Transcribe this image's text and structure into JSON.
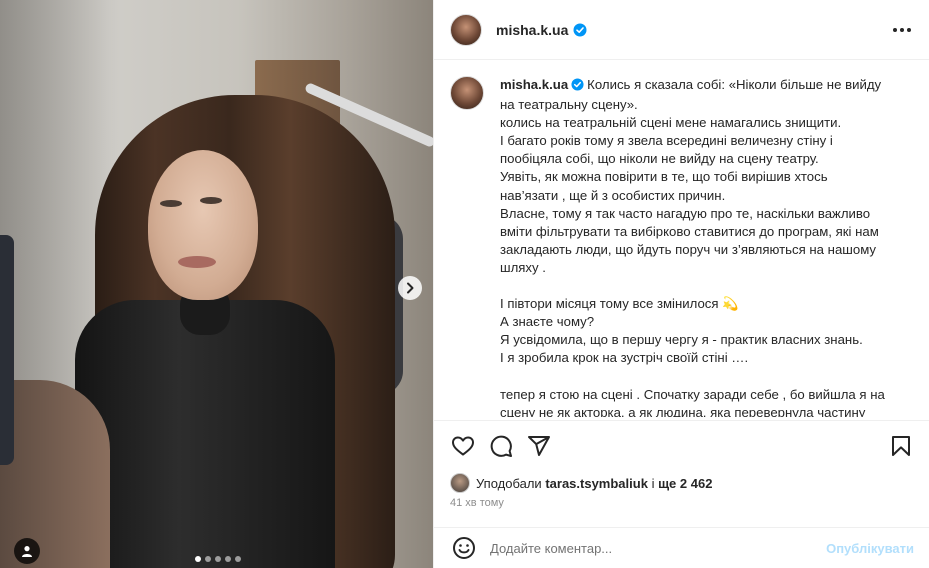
{
  "post": {
    "username": "misha.k.ua",
    "verified": true,
    "carousel": {
      "total_slides": 5,
      "current_slide": 1
    }
  },
  "caption": {
    "username": "misha.k.ua",
    "first_line": "Колись я сказала собі: «Ніколи більше не вийду",
    "lines": [
      "на театральну сцену».",
      "колись на театральній сцені мене намагались знищити.",
      "І багато років тому я звела всередині величезну стіну і",
      "пообіцяла собі, що ніколи не вийду на сцену театру.",
      "Уявіть, як можна повірити в те, що тобі вирішив хтось",
      "нав’язати , ще й з особистих причин.",
      "Власне, тому я так часто нагадую про те, наскільки важливо",
      "вміти фільтрувати та вибірково ставитися до програм, які нам",
      "закладають люди, що йдуть поруч чи з’являються на нашому",
      "шляху .",
      "",
      "І півтори місяця тому все змінилося 💫",
      "А знаєте чому?",
      "Я усвідомила, що в першу чергу я - практик власних знань.",
      "І я зробила крок на зустріч своїй стіні ….",
      "",
      "тепер я стою на сцені . Спочатку заради себе , бо вийшла я на",
      "сцену не як акторка, а як людина, яка перевернула частину"
    ]
  },
  "likes": {
    "prefix": "Уподобали",
    "user": "taras.tsymbaliuk",
    "connector": "і",
    "count": "ще 2 462"
  },
  "time_ago": "41 хв тому",
  "comment": {
    "placeholder": "Додайте коментар...",
    "post_label": "Опублікувати"
  },
  "colors": {
    "verified_blue": "#0095f6",
    "post_button_disabled": "#b2dffc",
    "secondary_text": "#8e8e8e"
  },
  "icons": {
    "actions": [
      "heart-icon",
      "comment-icon",
      "share-icon",
      "bookmark-icon"
    ],
    "other": [
      "more-icon",
      "chevron-right-icon",
      "user-tag-icon",
      "emoji-icon"
    ]
  }
}
